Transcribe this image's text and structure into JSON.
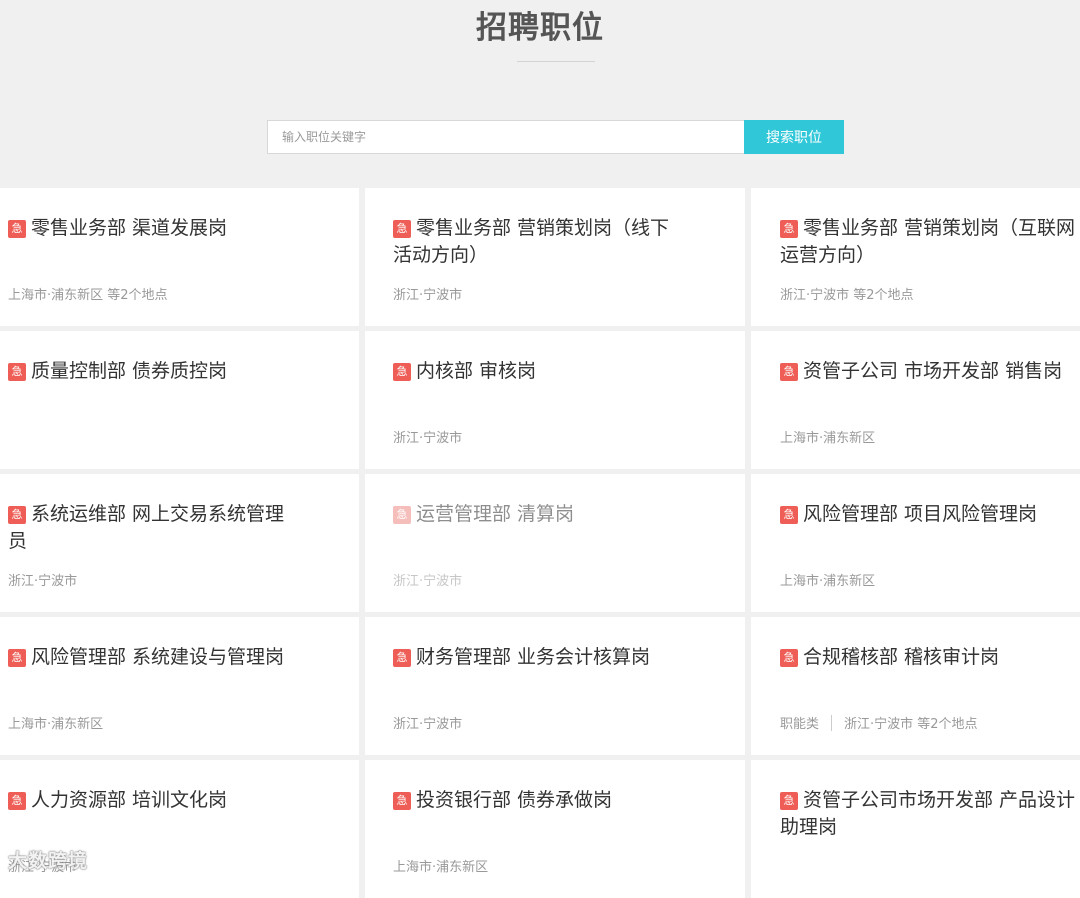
{
  "page": {
    "title": "招聘职位"
  },
  "search": {
    "placeholder": "输入职位关键字",
    "button_label": "搜索职位"
  },
  "urgent_badge": "急",
  "jobs": [
    {
      "title": "零售业务部 渠道发展岗",
      "location": "上海市·浦东新区 等2个地点",
      "category": "",
      "urgent": true
    },
    {
      "title": "零售业务部 营销策划岗（线下活动方向）",
      "location": "浙江·宁波市",
      "category": "",
      "urgent": true
    },
    {
      "title": "零售业务部 营销策划岗（互联网运营方向）",
      "location": "浙江·宁波市 等2个地点",
      "category": "",
      "urgent": true
    },
    {
      "title": "质量控制部 债券质控岗",
      "location": "",
      "category": "",
      "urgent": true
    },
    {
      "title": "内核部 审核岗",
      "location": "浙江·宁波市",
      "category": "",
      "urgent": true
    },
    {
      "title": "资管子公司 市场开发部 销售岗",
      "location": "上海市·浦东新区",
      "category": "",
      "urgent": true
    },
    {
      "title": "系统运维部 网上交易系统管理员",
      "location": "浙江·宁波市",
      "category": "",
      "urgent": true
    },
    {
      "title": "运营管理部 清算岗",
      "location": "浙江·宁波市",
      "category": "",
      "urgent": true,
      "dimmed": true
    },
    {
      "title": "风险管理部 项目风险管理岗",
      "location": "上海市·浦东新区",
      "category": "",
      "urgent": true
    },
    {
      "title": "风险管理部 系统建设与管理岗",
      "location": "上海市·浦东新区",
      "category": "",
      "urgent": true
    },
    {
      "title": "财务管理部 业务会计核算岗",
      "location": "浙江·宁波市",
      "category": "",
      "urgent": true
    },
    {
      "title": "合规稽核部 稽核审计岗",
      "location": "浙江·宁波市 等2个地点",
      "category": "职能类",
      "urgent": true
    },
    {
      "title": "人力资源部 培训文化岗",
      "location": "浙江·宁波市",
      "category": "",
      "urgent": true
    },
    {
      "title": "投资银行部 债券承做岗",
      "location": "上海市·浦东新区",
      "category": "",
      "urgent": true
    },
    {
      "title": "资管子公司市场开发部 产品设计助理岗",
      "location": "",
      "category": "",
      "urgent": true
    }
  ],
  "watermark": "大数跨境",
  "colors": {
    "accent": "#30c7d9",
    "urgent": "#ee5e56"
  }
}
